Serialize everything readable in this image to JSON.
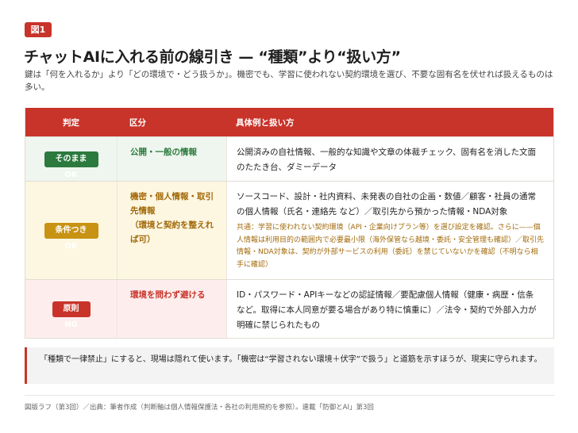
{
  "figure_tag": "図1",
  "title": "チャットAIに入れる前の線引き — “種類”より“扱い方”",
  "subtitle": "鍵は「何を入れるか」より「どの環境で・どう扱うか」。機密でも、学習に使われない契約環境を選び、不要な固有名を伏せれば扱えるものは多い。",
  "table": {
    "headers": [
      "判定",
      "区分",
      "具体例と扱い方"
    ],
    "rows": [
      {
        "verdict": "そのままOK",
        "category": "公開・一般の情報",
        "examples": "公開済みの自社情報、一般的な知識や文章の体裁チェック、固有名を消した文面のたたき台、ダミーデータ",
        "note": ""
      },
      {
        "verdict": "条件つきOK",
        "category": "機密・個人情報・取引先情報\n（環境と契約を整えれば可）",
        "examples": "ソースコード、設計・社内資料、未発表の自社の企画・数値／顧客・社員の通常の個人情報（氏名・連絡先 など）／取引先から預かった情報・NDA対象",
        "note": "共通：学習に使われない契約環境（API・企業向けプラン等）を選び設定を確認。さらに——個人情報は利用目的の範囲内で必要最小限（海外保管なら越境・委託・安全管理も確認）／取引先情報・NDA対象は、契約が外部サービスの利用（委託）を禁じていないかを確認（不明なら相手に確認）"
      },
      {
        "verdict": "原則NG",
        "category": "環境を問わず避ける",
        "examples": "ID・パスワード・APIキーなどの認証情報／要配慮個人情報（健康・病歴・信条 など。取得に本人同意が要る場合があり特に慎重に）／法令・契約で外部入力が明確に禁じられたもの",
        "note": ""
      }
    ]
  },
  "callout": "「種類で一律禁止」にすると、現場は隠れて使います。「機密は“学習されない環境＋伏字”で扱う」と道筋を示すほうが、現実に守られます。",
  "source": "図版ラフ（第3回）／出典：筆者作成（判断軸は個人情報保護法・各社の利用規約を参照）。連載「防御とAI」第3回",
  "colors": {
    "accent_red": "#c8342a",
    "ok_green": "#2c7a3e",
    "conditional_amber": "#c89312",
    "ng_red": "#c8342a"
  }
}
